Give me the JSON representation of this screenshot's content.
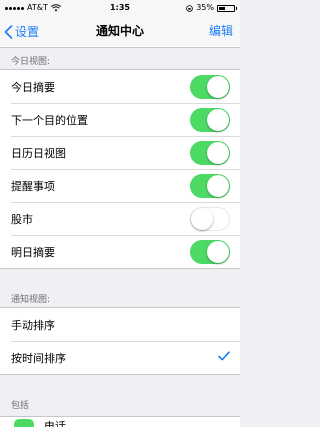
{
  "status_bar": {
    "carrier": "AT&T",
    "time": "1:35",
    "battery_percent": "35%",
    "battery_level": 0.35
  },
  "nav": {
    "back_label": "设置",
    "title": "通知中心",
    "edit_label": "编辑"
  },
  "today_view": {
    "header": "今日视图:",
    "items": [
      {
        "label": "今日摘要",
        "on": true
      },
      {
        "label": "下一个目的位置",
        "on": true
      },
      {
        "label": "日历日视图",
        "on": true
      },
      {
        "label": "提醒事项",
        "on": true
      },
      {
        "label": "股市",
        "on": false
      },
      {
        "label": "明日摘要",
        "on": true
      }
    ]
  },
  "notification_view": {
    "header": "通知视图:",
    "items": [
      {
        "label": "手动排序",
        "checked": false
      },
      {
        "label": "按时间排序",
        "checked": true
      }
    ]
  },
  "include": {
    "header": "包括",
    "partial_item": "电话"
  },
  "colors": {
    "accent": "#1a7cf5",
    "toggle_on": "#4cd964",
    "background": "#efeff4"
  }
}
